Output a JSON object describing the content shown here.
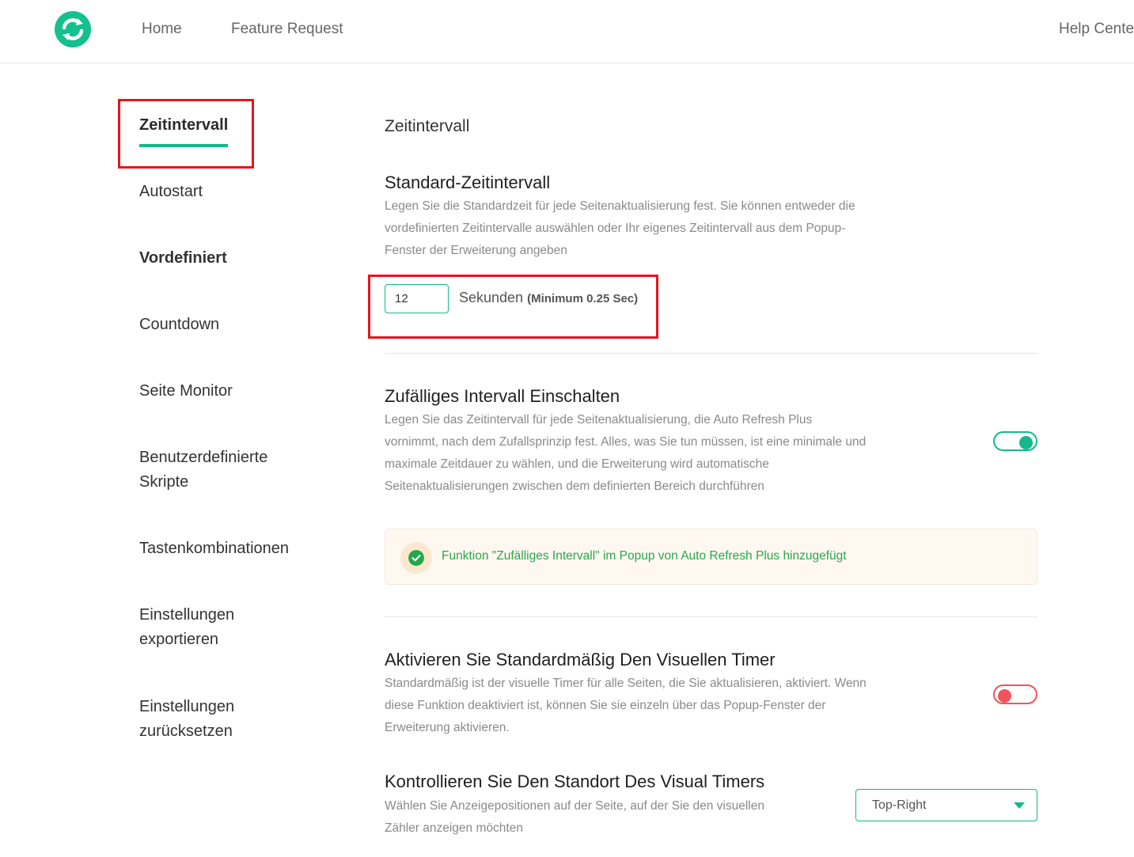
{
  "header": {
    "logo_icon": "refresh-logo-icon",
    "nav": {
      "home": "Home",
      "feature_request": "Feature Request",
      "help_center": "Help Center"
    }
  },
  "sidebar": {
    "items": [
      {
        "label": "Zeitintervall",
        "active": true
      },
      {
        "label": "Autostart"
      },
      {
        "label": "Vordefiniert"
      },
      {
        "label": "Countdown"
      },
      {
        "label": "Seite Monitor"
      },
      {
        "label": "Benutzerdefinierte Skripte"
      },
      {
        "label": "Tastenkombinationen"
      },
      {
        "label": "Einstellungen exportieren"
      },
      {
        "label": "Einstellungen zurücksetzen"
      }
    ]
  },
  "main": {
    "section_title": "Zeitintervall",
    "default_interval": {
      "title": "Standard-Zeitintervall",
      "description": "Legen Sie die Standardzeit für jede Seitenaktualisierung fest. Sie können entweder die vordefinierten Zeitintervalle auswählen oder Ihr eigenes Zeitintervall aus dem Popup-Fenster der Erweiterung angeben",
      "value": "12",
      "unit": "Sekunden",
      "hint": "(Minimum 0.25 Sec)"
    },
    "random_interval": {
      "title": "Zufälliges Intervall Einschalten",
      "description": "Legen Sie das Zeitintervall für jede Seitenaktualisierung, die Auto Refresh Plus vornimmt, nach dem Zufallsprinzip fest. Alles, was Sie tun müssen, ist eine minimale und maximale Zeitdauer zu wählen, und die Erweiterung wird automatische Seitenaktualisierungen zwischen dem definierten Bereich durchführen",
      "enabled": true,
      "notice": "Funktion \"Zufälliges Intervall\" im Popup von Auto Refresh Plus hinzugefügt"
    },
    "visual_timer": {
      "title": "Aktivieren Sie Standardmäßig Den Visuellen Timer",
      "description": "Standardmäßig ist der visuelle Timer für alle Seiten, die Sie aktualisieren, aktiviert. Wenn diese Funktion deaktiviert ist, können Sie sie einzeln über das Popup-Fenster der Erweiterung aktivieren.",
      "enabled": false
    },
    "timer_location": {
      "title": "Kontrollieren Sie Den Standort Des Visual Timers",
      "description": "Wählen Sie Anzeigepositionen auf der Seite, auf der Sie den visuellen Zähler anzeigen möchten",
      "selected": "Top-Right"
    }
  },
  "colors": {
    "accent": "#13b98a",
    "off": "#f0555c",
    "highlight": "#e8141c",
    "notice_text": "#27a84a"
  }
}
